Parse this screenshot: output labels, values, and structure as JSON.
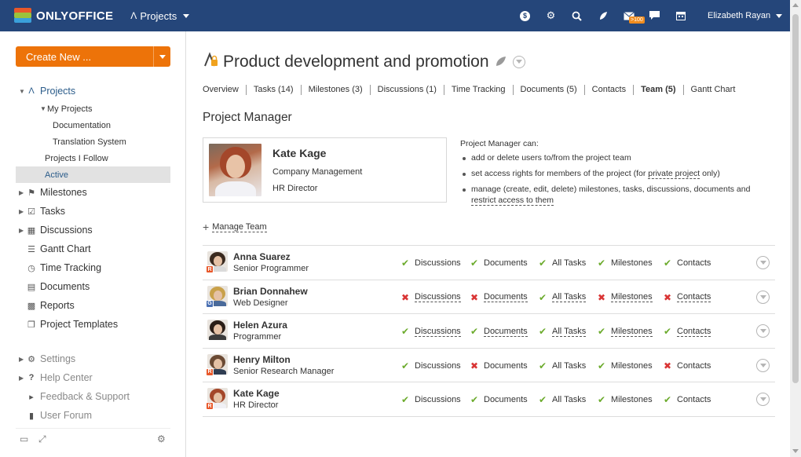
{
  "header": {
    "logo_text": "ONLYOFFICE",
    "module": "Projects",
    "mail_badge": ">100",
    "user": "Elizabeth Rayan",
    "icons": [
      "billing-icon",
      "settings-icon",
      "search-icon",
      "feed-icon",
      "mail-icon",
      "chat-icon",
      "calendar-icon"
    ],
    "colors": {
      "bar": "#25467a",
      "badge": "#f08c1e"
    }
  },
  "sidebar": {
    "create_label": "Create New ...",
    "projects_label": "Projects",
    "projects_sub": [
      {
        "label": "My Projects"
      },
      {
        "label": "Documentation"
      },
      {
        "label": "Translation System"
      },
      {
        "label": "Projects I Follow"
      },
      {
        "label": "Active"
      }
    ],
    "items": [
      {
        "label": "Milestones",
        "icon": "flag-icon"
      },
      {
        "label": "Tasks",
        "icon": "checkbox-icon"
      },
      {
        "label": "Discussions",
        "icon": "discussions-icon"
      },
      {
        "label": "Gantt Chart",
        "icon": "gantt-icon"
      },
      {
        "label": "Time Tracking",
        "icon": "clock-icon"
      },
      {
        "label": "Documents",
        "icon": "documents-icon"
      },
      {
        "label": "Reports",
        "icon": "reports-icon"
      },
      {
        "label": "Project Templates",
        "icon": "templates-icon"
      }
    ],
    "extra_items": [
      {
        "label": "Settings",
        "icon": "gear-icon"
      },
      {
        "label": "Help Center",
        "icon": "help-icon"
      },
      {
        "label": "Feedback & Support",
        "icon": "megaphone-icon"
      },
      {
        "label": "User Forum",
        "icon": "forum-icon"
      }
    ],
    "create_color": "#ed7309"
  },
  "project": {
    "title": "Product development and promotion",
    "tabs": [
      {
        "label": "Overview"
      },
      {
        "label": "Tasks (14)"
      },
      {
        "label": "Milestones (3)"
      },
      {
        "label": "Discussions (1)"
      },
      {
        "label": "Time Tracking"
      },
      {
        "label": "Documents (5)"
      },
      {
        "label": "Contacts"
      },
      {
        "label": "Team (5)",
        "active": true
      },
      {
        "label": "Gantt Chart"
      }
    ]
  },
  "manager": {
    "section_title": "Project Manager",
    "name": "Kate Kage",
    "department": "Company Management",
    "role": "HR Director",
    "rights_heading": "Project Manager can:",
    "right1": "add or delete users to/from the project team",
    "right2_a": "set access rights for members of the project (for ",
    "right2_link": "private project",
    "right2_b": " only)",
    "right3_a": "manage (create, edit, delete) milestones, tasks, discussions, documents and ",
    "right3_link": "restrict access to them"
  },
  "manage_team_label": "Manage Team",
  "team": [
    {
      "name": "Anna Suarez",
      "title": "Senior Programmer",
      "badge": "R",
      "badge_color": "#e8582a",
      "hair": "#3a2a1f",
      "body": "#dadada",
      "perms": [
        {
          "label": "Discussions",
          "ok": true,
          "link": false
        },
        {
          "label": "Documents",
          "ok": true,
          "link": false
        },
        {
          "label": "All Tasks",
          "ok": true,
          "link": false
        },
        {
          "label": "Milestones",
          "ok": true,
          "link": false
        },
        {
          "label": "Contacts",
          "ok": true,
          "link": false
        }
      ]
    },
    {
      "name": "Brian Donnahew",
      "title": "Web Designer",
      "badge": "G",
      "badge_color": "#4a70b3",
      "hair": "#c9a14a",
      "body": "#4a6a9a",
      "perms": [
        {
          "label": "Discussions",
          "ok": false,
          "link": true
        },
        {
          "label": "Documents",
          "ok": false,
          "link": true
        },
        {
          "label": "All Tasks",
          "ok": true,
          "link": true
        },
        {
          "label": "Milestones",
          "ok": false,
          "link": true
        },
        {
          "label": "Contacts",
          "ok": false,
          "link": true
        }
      ]
    },
    {
      "name": "Helen Azura",
      "title": "Programmer",
      "badge": "",
      "badge_color": "",
      "hair": "#2a1d16",
      "body": "#3c3c3c",
      "perms": [
        {
          "label": "Discussions",
          "ok": true,
          "link": true
        },
        {
          "label": "Documents",
          "ok": true,
          "link": true
        },
        {
          "label": "All Tasks",
          "ok": true,
          "link": true
        },
        {
          "label": "Milestones",
          "ok": true,
          "link": true
        },
        {
          "label": "Contacts",
          "ok": true,
          "link": true
        }
      ]
    },
    {
      "name": "Henry Milton",
      "title": "Senior Research Manager",
      "badge": "R",
      "badge_color": "#e8582a",
      "hair": "#6b4a34",
      "body": "#2f3d52",
      "perms": [
        {
          "label": "Discussions",
          "ok": true,
          "link": false
        },
        {
          "label": "Documents",
          "ok": false,
          "link": false
        },
        {
          "label": "All Tasks",
          "ok": true,
          "link": false
        },
        {
          "label": "Milestones",
          "ok": true,
          "link": false
        },
        {
          "label": "Contacts",
          "ok": false,
          "link": false
        }
      ]
    },
    {
      "name": "Kate Kage",
      "title": "HR Director",
      "badge": "R",
      "badge_color": "#e8582a",
      "hair": "#a4472a",
      "body": "#f0f0f4",
      "perms": [
        {
          "label": "Discussions",
          "ok": true,
          "link": false
        },
        {
          "label": "Documents",
          "ok": true,
          "link": false
        },
        {
          "label": "All Tasks",
          "ok": true,
          "link": false
        },
        {
          "label": "Milestones",
          "ok": true,
          "link": false
        },
        {
          "label": "Contacts",
          "ok": true,
          "link": false
        }
      ]
    }
  ]
}
